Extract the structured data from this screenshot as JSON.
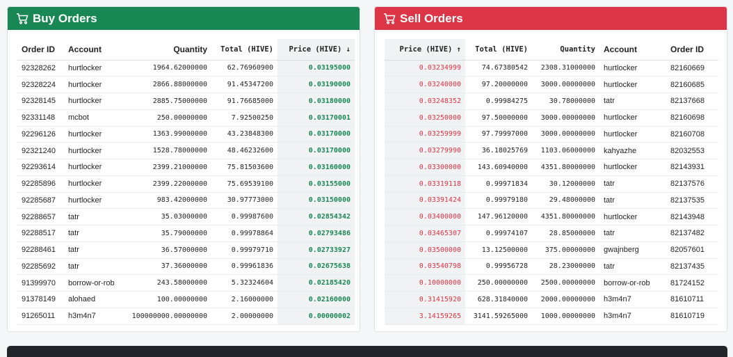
{
  "buy": {
    "title": "Buy Orders",
    "headers": {
      "order_id": "Order ID",
      "account": "Account",
      "quantity": "Quantity",
      "total": "Total (HIVE)",
      "price": "Price (HIVE) ↓"
    },
    "rows": [
      {
        "order_id": "92328262",
        "account": "hurtlocker",
        "quantity": "1964.62000000",
        "total": "62.76960900",
        "price": "0.03195000"
      },
      {
        "order_id": "92328224",
        "account": "hurtlocker",
        "quantity": "2866.88000000",
        "total": "91.45347200",
        "price": "0.03190000"
      },
      {
        "order_id": "92328145",
        "account": "hurtlocker",
        "quantity": "2885.75000000",
        "total": "91.76685000",
        "price": "0.03180000"
      },
      {
        "order_id": "92331148",
        "account": "mcbot",
        "quantity": "250.00000000",
        "total": "7.92500250",
        "price": "0.03170001"
      },
      {
        "order_id": "92296126",
        "account": "hurtlocker",
        "quantity": "1363.99000000",
        "total": "43.23848300",
        "price": "0.03170000"
      },
      {
        "order_id": "92321240",
        "account": "hurtlocker",
        "quantity": "1528.78000000",
        "total": "48.46232600",
        "price": "0.03170000"
      },
      {
        "order_id": "92293614",
        "account": "hurtlocker",
        "quantity": "2399.21000000",
        "total": "75.81503600",
        "price": "0.03160000"
      },
      {
        "order_id": "92285896",
        "account": "hurtlocker",
        "quantity": "2399.22000000",
        "total": "75.69539100",
        "price": "0.03155000"
      },
      {
        "order_id": "92285687",
        "account": "hurtlocker",
        "quantity": "983.42000000",
        "total": "30.97773000",
        "price": "0.03150000"
      },
      {
        "order_id": "92288657",
        "account": "tatr",
        "quantity": "35.03000000",
        "total": "0.99987600",
        "price": "0.02854342"
      },
      {
        "order_id": "92288517",
        "account": "tatr",
        "quantity": "35.79000000",
        "total": "0.99978864",
        "price": "0.02793486"
      },
      {
        "order_id": "92288461",
        "account": "tatr",
        "quantity": "36.57000000",
        "total": "0.99979710",
        "price": "0.02733927"
      },
      {
        "order_id": "92285692",
        "account": "tatr",
        "quantity": "37.36000000",
        "total": "0.99961836",
        "price": "0.02675638"
      },
      {
        "order_id": "91399970",
        "account": "borrow-or-rob",
        "quantity": "243.58000000",
        "total": "5.32324604",
        "price": "0.02185420"
      },
      {
        "order_id": "91378149",
        "account": "alohaed",
        "quantity": "100.00000000",
        "total": "2.16000000",
        "price": "0.02160000"
      },
      {
        "order_id": "91265011",
        "account": "h3m4n7",
        "quantity": "100000000.00000000",
        "total": "2.00000000",
        "price": "0.00000002"
      }
    ]
  },
  "sell": {
    "title": "Sell Orders",
    "headers": {
      "price": "Price (HIVE) ↑",
      "total": "Total (HIVE)",
      "quantity": "Quantity",
      "account": "Account",
      "order_id": "Order ID"
    },
    "rows": [
      {
        "price": "0.03234999",
        "total": "74.67380542",
        "quantity": "2308.31000000",
        "account": "hurtlocker",
        "order_id": "82160669"
      },
      {
        "price": "0.03240000",
        "total": "97.20000000",
        "quantity": "3000.00000000",
        "account": "hurtlocker",
        "order_id": "82160685"
      },
      {
        "price": "0.03248352",
        "total": "0.99984275",
        "quantity": "30.78000000",
        "account": "tatr",
        "order_id": "82137668"
      },
      {
        "price": "0.03250000",
        "total": "97.50000000",
        "quantity": "3000.00000000",
        "account": "hurtlocker",
        "order_id": "82160698"
      },
      {
        "price": "0.03259999",
        "total": "97.79997000",
        "quantity": "3000.00000000",
        "account": "hurtlocker",
        "order_id": "82160708"
      },
      {
        "price": "0.03279990",
        "total": "36.18025769",
        "quantity": "1103.06000000",
        "account": "kahyazhe",
        "order_id": "82032553"
      },
      {
        "price": "0.03300000",
        "total": "143.60940000",
        "quantity": "4351.80000000",
        "account": "hurtlocker",
        "order_id": "82143931"
      },
      {
        "price": "0.03319118",
        "total": "0.99971834",
        "quantity": "30.12000000",
        "account": "tatr",
        "order_id": "82137576"
      },
      {
        "price": "0.03391424",
        "total": "0.99979180",
        "quantity": "29.48000000",
        "account": "tatr",
        "order_id": "82137535"
      },
      {
        "price": "0.03400000",
        "total": "147.96120000",
        "quantity": "4351.80000000",
        "account": "hurtlocker",
        "order_id": "82143948"
      },
      {
        "price": "0.03465307",
        "total": "0.99974107",
        "quantity": "28.85000000",
        "account": "tatr",
        "order_id": "82137482"
      },
      {
        "price": "0.03500000",
        "total": "13.12500000",
        "quantity": "375.00000000",
        "account": "gwajnberg",
        "order_id": "82057601"
      },
      {
        "price": "0.03540798",
        "total": "0.99956728",
        "quantity": "28.23000000",
        "account": "tatr",
        "order_id": "82137435"
      },
      {
        "price": "0.10000000",
        "total": "250.00000000",
        "quantity": "2500.00000000",
        "account": "borrow-or-rob",
        "order_id": "81724152"
      },
      {
        "price": "0.31415920",
        "total": "628.31840000",
        "quantity": "2000.00000000",
        "account": "h3m4n7",
        "order_id": "81610711"
      },
      {
        "price": "3.14159265",
        "total": "3141.59265000",
        "quantity": "1000.00000000",
        "account": "h3m4n7",
        "order_id": "81610719"
      }
    ]
  },
  "icons": {
    "header": "cart-icon"
  },
  "colors": {
    "buy_accent": "#198754",
    "sell_accent": "#dc3545"
  }
}
